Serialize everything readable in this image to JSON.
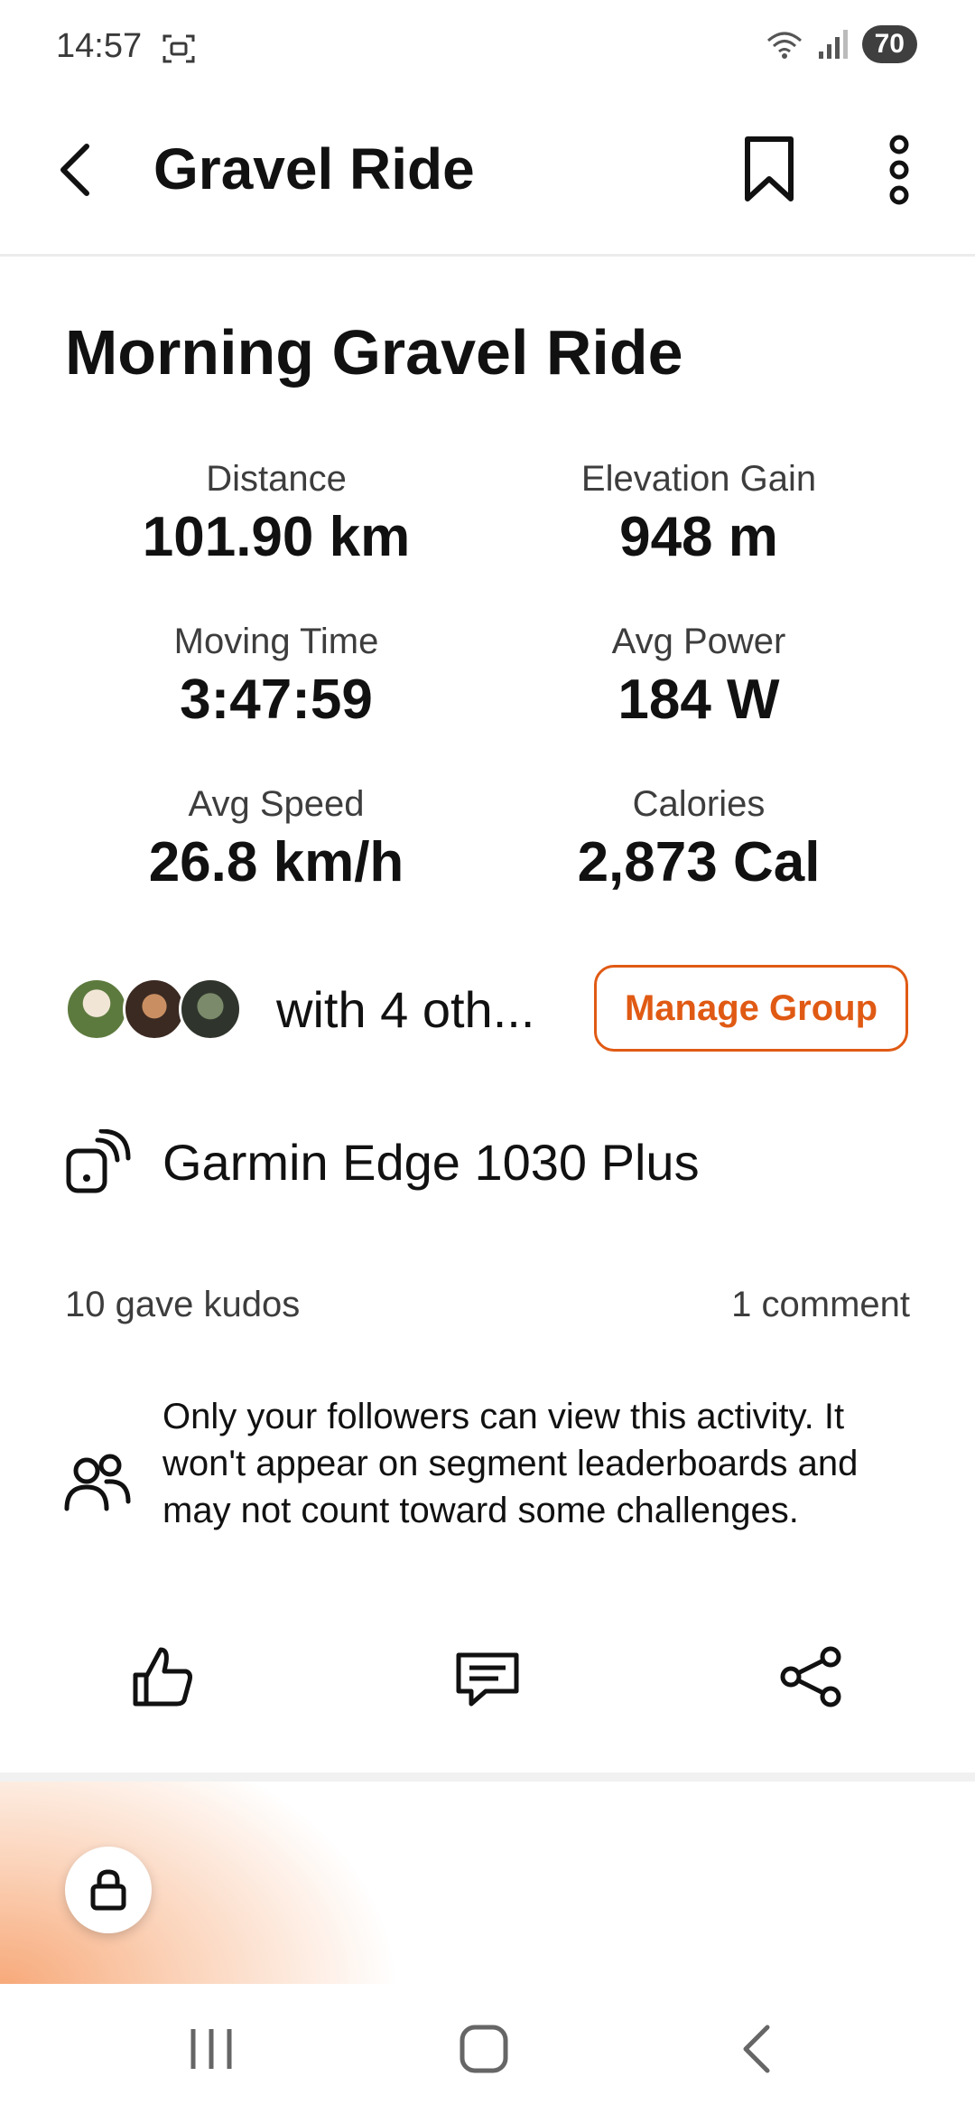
{
  "status_bar": {
    "time": "14:57",
    "battery": "70"
  },
  "app_bar": {
    "title": "Gravel Ride"
  },
  "activity": {
    "title": "Morning Gravel Ride"
  },
  "stats": [
    {
      "label": "Distance",
      "value": "101.90 km"
    },
    {
      "label": "Elevation Gain",
      "value": "948 m"
    },
    {
      "label": "Moving Time",
      "value": "3:47:59"
    },
    {
      "label": "Avg Power",
      "value": "184 W"
    },
    {
      "label": "Avg Speed",
      "value": "26.8 km/h"
    },
    {
      "label": "Calories",
      "value": "2,873 Cal"
    }
  ],
  "group": {
    "with_text": "with 4 oth...",
    "manage_label": "Manage Group"
  },
  "device": {
    "name": "Garmin Edge 1030 Plus",
    "icon": "device-sync-icon"
  },
  "social": {
    "kudos": "10 gave kudos",
    "comments": "1 comment"
  },
  "privacy": {
    "text": "Only your followers can view this activity. It won't appear on segment leaderboards and may not count toward some challenges.",
    "icon": "followers-icon"
  },
  "actions": {
    "kudos_icon": "thumbs-up-icon",
    "comment_icon": "comment-icon",
    "share_icon": "share-icon"
  },
  "colors": {
    "accent": "#e05a14"
  }
}
